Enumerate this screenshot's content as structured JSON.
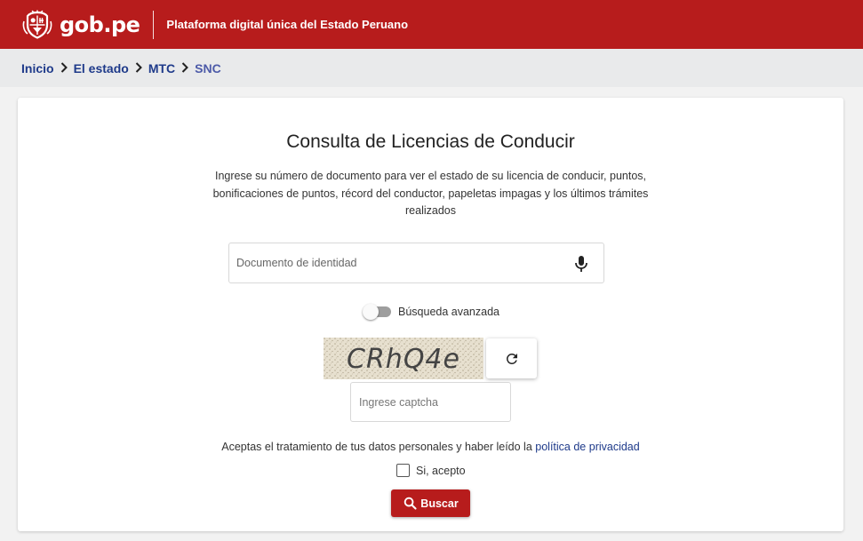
{
  "header": {
    "logo_text": "gob.pe",
    "platform_title": "Plataforma digital única del Estado Peruano",
    "brand_color": "#b71c1c",
    "logo_icon": "peru-coat-of-arms-icon"
  },
  "breadcrumb": {
    "items": [
      "Inicio",
      "El estado",
      "MTC",
      "SNC"
    ],
    "separator_icon": "chevron-right-icon"
  },
  "main": {
    "title": "Consulta de Licencias de Conducir",
    "description": "Ingrese su número de documento para ver el estado de su licencia de conducir, puntos, bonificaciones de puntos, récord del conductor, papeletas impagas y los últimos trámites realizados",
    "document_field": {
      "placeholder": "Documento de identidad",
      "value": "",
      "icon": "microphone-icon"
    },
    "advanced_search": {
      "label": "Búsqueda avanzada",
      "enabled": false
    },
    "captcha": {
      "text": "CRhQ4e",
      "refresh_icon": "refresh-icon"
    },
    "captcha_field": {
      "placeholder": "Ingrese captcha",
      "value": ""
    },
    "consent": {
      "text": "Aceptas el tratamiento de tus datos personales y haber leído la",
      "link_text": "política de privacidad"
    },
    "accept": {
      "label": "Si, acepto",
      "checked": false
    },
    "search_button": {
      "label": "Buscar",
      "icon": "search-icon"
    }
  }
}
